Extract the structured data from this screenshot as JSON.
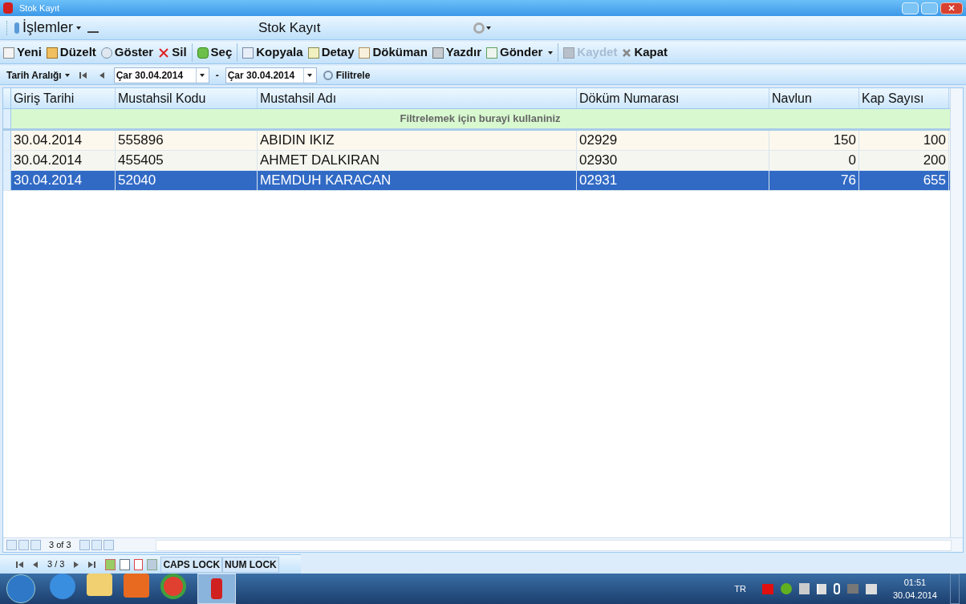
{
  "window": {
    "title": "Stok Kayıt"
  },
  "menu_bar": {
    "menu": "İşlemler",
    "title": "Stok Kayıt"
  },
  "toolbar": [
    [
      {
        "label": "Yeni",
        "disabled": false,
        "dropdown": false
      },
      {
        "label": "Düzelt",
        "disabled": false,
        "dropdown": false
      },
      {
        "label": "Göster",
        "disabled": false,
        "dropdown": false
      },
      {
        "label": "Sil",
        "disabled": false,
        "dropdown": false
      }
    ],
    [
      {
        "label": "Seç",
        "disabled": false,
        "dropdown": false
      }
    ],
    [
      {
        "label": "Kopyala",
        "disabled": false,
        "dropdown": false
      },
      {
        "label": "Detay",
        "disabled": false,
        "dropdown": false
      },
      {
        "label": "Döküman",
        "disabled": false,
        "dropdown": false
      },
      {
        "label": "Yazdır",
        "disabled": false,
        "dropdown": false
      },
      {
        "label": "Gönder",
        "disabled": false,
        "dropdown": true
      }
    ],
    [
      {
        "label": "Kaydet",
        "disabled": true,
        "dropdown": false
      },
      {
        "label": "Kapat",
        "disabled": false,
        "dropdown": false
      }
    ]
  ],
  "filter_bar": {
    "range_label": "Tarih  Aralığı",
    "date_from": "Çar 30.04.2014",
    "separator": "-",
    "date_to": "Çar 30.04.2014",
    "filter_button": "Filitrele"
  },
  "table": {
    "columns": [
      {
        "label": "Giriş Tarihi"
      },
      {
        "label": "Mustahsil Kodu"
      },
      {
        "label": "Mustahsil Adı"
      },
      {
        "label": "Döküm Numarası"
      },
      {
        "label": "Navlun"
      },
      {
        "label": "Kap Sayısı"
      }
    ],
    "filter_row": "Filtrelemek için burayi kullaniniz",
    "rows": [
      {
        "cells": [
          "30.04.2014",
          "555896",
          "ABIDIN IKIZ",
          "02929",
          "150",
          "100"
        ],
        "selected": false
      },
      {
        "cells": [
          "30.04.2014",
          "455405",
          "AHMET DALKIRAN",
          "02930",
          "0",
          "200"
        ],
        "selected": false
      },
      {
        "cells": [
          "30.04.2014",
          "52040",
          "MEMDUH KARACAN",
          "02931",
          "76",
          "655"
        ],
        "selected": true
      }
    ],
    "pager": "3 of 3"
  },
  "status_bar": {
    "position": "3 / 3",
    "caps_lock": "CAPS LOCK",
    "num_lock": "NUM LOCK"
  },
  "taskbar": {
    "language": "TR",
    "time": "01:51",
    "date": "30.04.2014"
  }
}
